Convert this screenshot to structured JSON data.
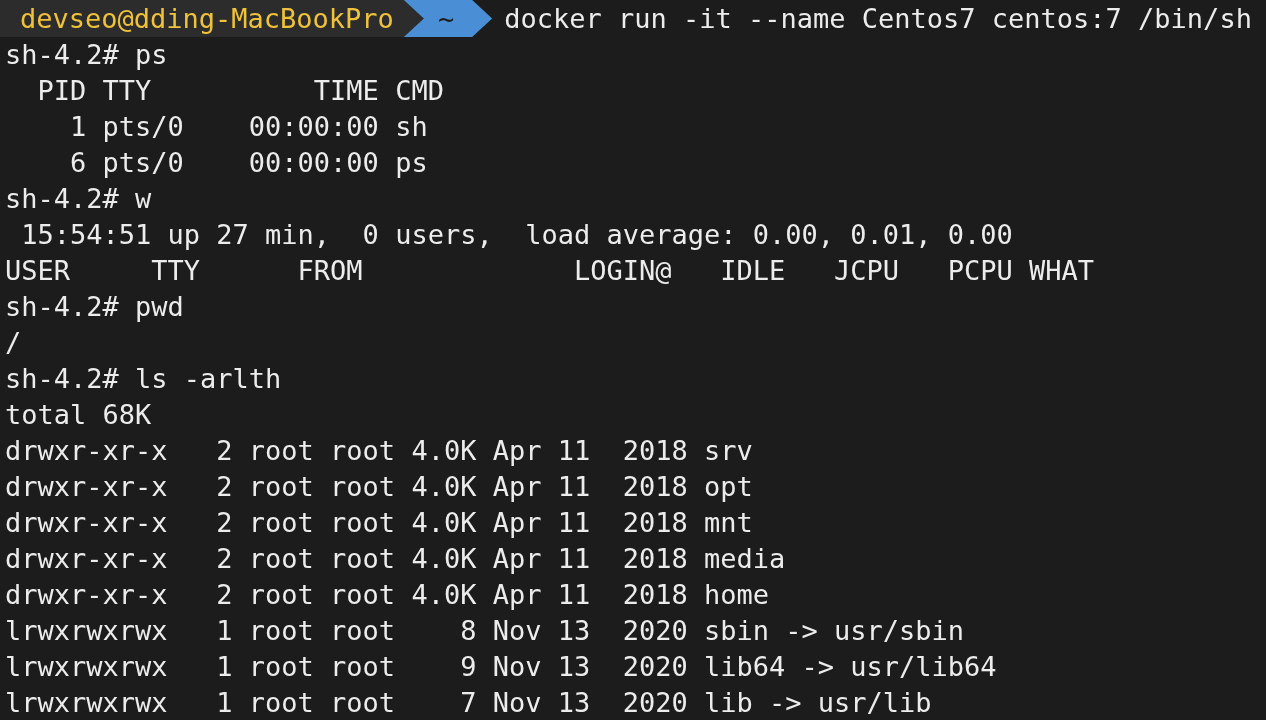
{
  "prompt": {
    "user_host": "devseo@dding-MacBookPro",
    "directory": "~",
    "command": "docker run -it --name Centos7 centos:7 /bin/sh"
  },
  "lines": [
    "sh-4.2# ps",
    "  PID TTY          TIME CMD",
    "    1 pts/0    00:00:00 sh",
    "    6 pts/0    00:00:00 ps",
    "sh-4.2# w",
    " 15:54:51 up 27 min,  0 users,  load average: 0.00, 0.01, 0.00",
    "USER     TTY      FROM             LOGIN@   IDLE   JCPU   PCPU WHAT",
    "sh-4.2# pwd",
    "/",
    "sh-4.2# ls -arlth",
    "total 68K",
    "drwxr-xr-x   2 root root 4.0K Apr 11  2018 srv",
    "drwxr-xr-x   2 root root 4.0K Apr 11  2018 opt",
    "drwxr-xr-x   2 root root 4.0K Apr 11  2018 mnt",
    "drwxr-xr-x   2 root root 4.0K Apr 11  2018 media",
    "drwxr-xr-x   2 root root 4.0K Apr 11  2018 home",
    "lrwxrwxrwx   1 root root    8 Nov 13  2020 sbin -> usr/sbin",
    "lrwxrwxrwx   1 root root    9 Nov 13  2020 lib64 -> usr/lib64",
    "lrwxrwxrwx   1 root root    7 Nov 13  2020 lib -> usr/lib"
  ]
}
